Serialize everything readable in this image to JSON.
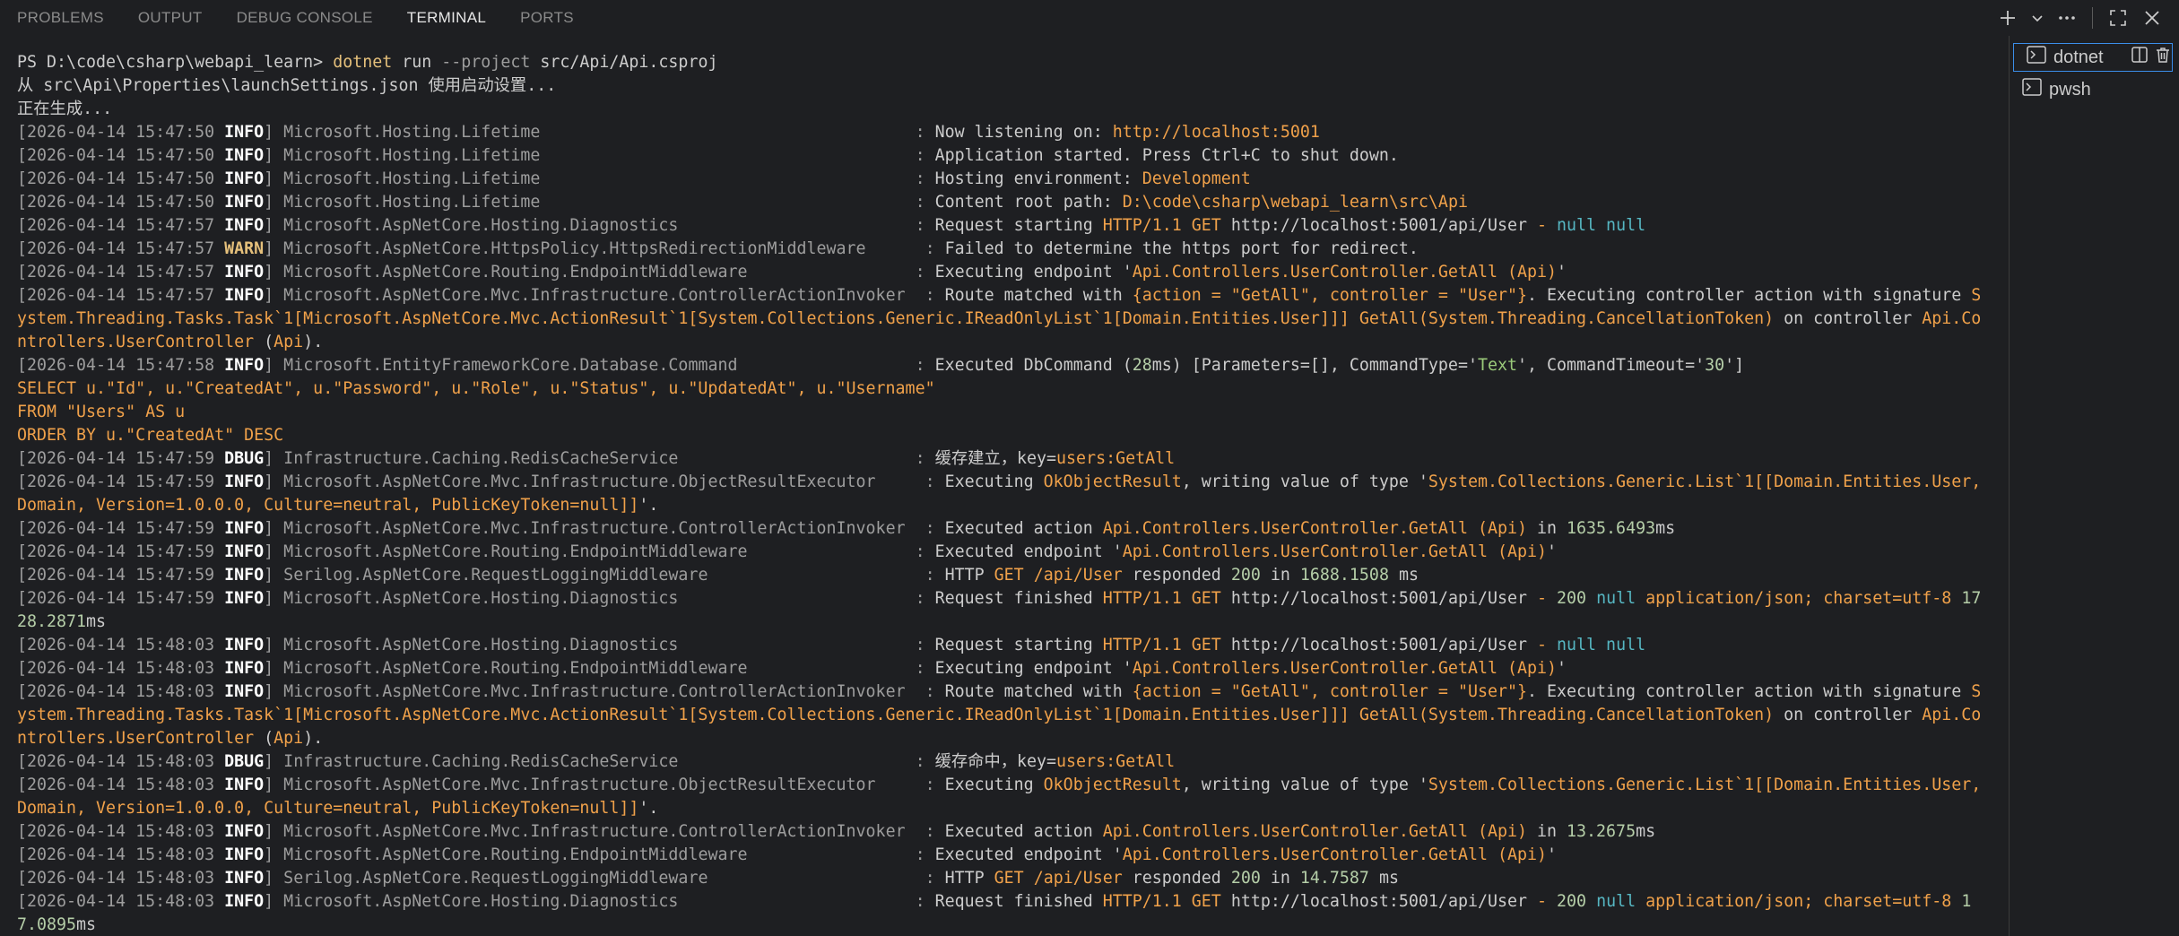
{
  "tabs": [
    {
      "label": "PROBLEMS"
    },
    {
      "label": "OUTPUT"
    },
    {
      "label": "DEBUG CONSOLE"
    },
    {
      "label": "TERMINAL"
    },
    {
      "label": "PORTS"
    }
  ],
  "active_tab": 3,
  "terminals": [
    {
      "label": "dotnet"
    },
    {
      "label": "pwsh"
    }
  ],
  "colors": {
    "background": "#1e1f22",
    "accent": "#3b8eea",
    "info": "#ffffff",
    "warn": "#e5c07b",
    "string": "#f0a14a",
    "keyword_null": "#56b6c2",
    "value_green": "#9ac97a"
  },
  "lines": [
    [
      {
        "t": "PS D:\\code\\csharp\\webapi_learn> ",
        "c": "default"
      },
      {
        "t": "dotnet",
        "c": "cmd"
      },
      {
        "t": " run ",
        "c": "default"
      },
      {
        "t": "--project",
        "c": "flag"
      },
      {
        "t": " src/Api/Api.csproj",
        "c": "default"
      }
    ],
    [
      {
        "t": "从 src\\Api\\Properties\\launchSettings.json 使用启动设置...",
        "c": "default"
      }
    ],
    [
      {
        "t": "正在生成...",
        "c": "default"
      }
    ],
    [
      {
        "t": "[2026-04-14 15:47:50 ",
        "c": "dim"
      },
      {
        "t": "INFO",
        "c": "white"
      },
      {
        "t": "] Microsoft.Hosting.Lifetime                                      : ",
        "c": "dim"
      },
      {
        "t": "Now listening on: ",
        "c": "default"
      },
      {
        "t": "http://localhost:5001",
        "c": "orange"
      }
    ],
    [
      {
        "t": "[2026-04-14 15:47:50 ",
        "c": "dim"
      },
      {
        "t": "INFO",
        "c": "white"
      },
      {
        "t": "] Microsoft.Hosting.Lifetime                                      : ",
        "c": "dim"
      },
      {
        "t": "Application started. Press Ctrl+C to shut down.",
        "c": "default"
      }
    ],
    [
      {
        "t": "[2026-04-14 15:47:50 ",
        "c": "dim"
      },
      {
        "t": "INFO",
        "c": "white"
      },
      {
        "t": "] Microsoft.Hosting.Lifetime                                      : ",
        "c": "dim"
      },
      {
        "t": "Hosting environment: ",
        "c": "default"
      },
      {
        "t": "Development",
        "c": "orange"
      }
    ],
    [
      {
        "t": "[2026-04-14 15:47:50 ",
        "c": "dim"
      },
      {
        "t": "INFO",
        "c": "white"
      },
      {
        "t": "] Microsoft.Hosting.Lifetime                                      : ",
        "c": "dim"
      },
      {
        "t": "Content root path: ",
        "c": "default"
      },
      {
        "t": "D:\\code\\csharp\\webapi_learn\\src\\Api",
        "c": "orange"
      }
    ],
    [
      {
        "t": "[2026-04-14 15:47:57 ",
        "c": "dim"
      },
      {
        "t": "INFO",
        "c": "white"
      },
      {
        "t": "] Microsoft.AspNetCore.Hosting.Diagnostics                        : ",
        "c": "dim"
      },
      {
        "t": "Request starting ",
        "c": "default"
      },
      {
        "t": "HTTP/1.1 GET ",
        "c": "orange"
      },
      {
        "t": "http://localhost:5001/api/User",
        "c": "default"
      },
      {
        "t": " - ",
        "c": "orange"
      },
      {
        "t": "null null",
        "c": "cyan"
      }
    ],
    [
      {
        "t": "[2026-04-14 15:47:57 ",
        "c": "dim"
      },
      {
        "t": "WARN",
        "c": "warn"
      },
      {
        "t": "] Microsoft.AspNetCore.HttpsPolicy.HttpsRedirectionMiddleware      : ",
        "c": "dim"
      },
      {
        "t": "Failed to determine the https port for redirect.",
        "c": "default"
      }
    ],
    [
      {
        "t": "[2026-04-14 15:47:57 ",
        "c": "dim"
      },
      {
        "t": "INFO",
        "c": "white"
      },
      {
        "t": "] Microsoft.AspNetCore.Routing.EndpointMiddleware                 : ",
        "c": "dim"
      },
      {
        "t": "Executing endpoint '",
        "c": "default"
      },
      {
        "t": "Api.Controllers.UserController.GetAll (Api)",
        "c": "orange"
      },
      {
        "t": "'",
        "c": "default"
      }
    ],
    [
      {
        "t": "[2026-04-14 15:47:57 ",
        "c": "dim"
      },
      {
        "t": "INFO",
        "c": "white"
      },
      {
        "t": "] Microsoft.AspNetCore.Mvc.Infrastructure.ControllerActionInvoker  : ",
        "c": "dim"
      },
      {
        "t": "Route matched with ",
        "c": "default"
      },
      {
        "t": "{action = \"GetAll\", controller = \"User\"}",
        "c": "orange"
      },
      {
        "t": ". Executing controller action with signature ",
        "c": "default"
      },
      {
        "t": "System.Threading.Tasks.Task`1[Microsoft.AspNetCore.Mvc.ActionResult`1[System.Collections.Generic.IReadOnlyList`1[Domain.Entities.User]]] GetAll(System.Threading.CancellationToken)",
        "c": "orange"
      },
      {
        "t": " on controller ",
        "c": "default"
      },
      {
        "t": "Api.Controllers.UserController",
        "c": "orange"
      },
      {
        "t": " (",
        "c": "default"
      },
      {
        "t": "Api",
        "c": "orange"
      },
      {
        "t": ").",
        "c": "default"
      }
    ],
    [
      {
        "t": "[2026-04-14 15:47:58 ",
        "c": "dim"
      },
      {
        "t": "INFO",
        "c": "white"
      },
      {
        "t": "] Microsoft.EntityFrameworkCore.Database.Command                  : ",
        "c": "dim"
      },
      {
        "t": "Executed DbCommand (",
        "c": "default"
      },
      {
        "t": "28",
        "c": "num"
      },
      {
        "t": "ms) [Parameters=[], CommandType='",
        "c": "default"
      },
      {
        "t": "Text",
        "c": "green"
      },
      {
        "t": "', CommandTimeout='",
        "c": "default"
      },
      {
        "t": "30",
        "c": "num"
      },
      {
        "t": "']",
        "c": "default"
      }
    ],
    [
      {
        "t": "SELECT u.\"Id\", u.\"CreatedAt\", u.\"Password\", u.\"Role\", u.\"Status\", u.\"UpdatedAt\", u.\"Username\"",
        "c": "orange"
      }
    ],
    [
      {
        "t": "FROM \"Users\" AS u",
        "c": "orange"
      }
    ],
    [
      {
        "t": "ORDER BY u.\"CreatedAt\" DESC",
        "c": "orange"
      }
    ],
    [
      {
        "t": "[2026-04-14 15:47:59 ",
        "c": "dim"
      },
      {
        "t": "DBUG",
        "c": "white"
      },
      {
        "t": "] Infrastructure.Caching.RedisCacheService                        : ",
        "c": "dim"
      },
      {
        "t": "缓存建立，key=",
        "c": "default"
      },
      {
        "t": "users:GetAll",
        "c": "orange"
      }
    ],
    [
      {
        "t": "[2026-04-14 15:47:59 ",
        "c": "dim"
      },
      {
        "t": "INFO",
        "c": "white"
      },
      {
        "t": "] Microsoft.AspNetCore.Mvc.Infrastructure.ObjectResultExecutor     : ",
        "c": "dim"
      },
      {
        "t": "Executing ",
        "c": "default"
      },
      {
        "t": "OkObjectResult",
        "c": "orange"
      },
      {
        "t": ", writing value of type '",
        "c": "default"
      },
      {
        "t": "System.Collections.Generic.List`1[[Domain.Entities.User, Domain, Version=1.0.0.0, Culture=neutral, PublicKeyToken=null]]",
        "c": "orange"
      },
      {
        "t": "'.",
        "c": "default"
      }
    ],
    [
      {
        "t": "[2026-04-14 15:47:59 ",
        "c": "dim"
      },
      {
        "t": "INFO",
        "c": "white"
      },
      {
        "t": "] Microsoft.AspNetCore.Mvc.Infrastructure.ControllerActionInvoker  : ",
        "c": "dim"
      },
      {
        "t": "Executed action ",
        "c": "default"
      },
      {
        "t": "Api.Controllers.UserController.GetAll (Api)",
        "c": "orange"
      },
      {
        "t": " in ",
        "c": "default"
      },
      {
        "t": "1635.6493",
        "c": "num"
      },
      {
        "t": "ms",
        "c": "default"
      }
    ],
    [
      {
        "t": "[2026-04-14 15:47:59 ",
        "c": "dim"
      },
      {
        "t": "INFO",
        "c": "white"
      },
      {
        "t": "] Microsoft.AspNetCore.Routing.EndpointMiddleware                 : ",
        "c": "dim"
      },
      {
        "t": "Executed endpoint '",
        "c": "default"
      },
      {
        "t": "Api.Controllers.UserController.GetAll (Api)",
        "c": "orange"
      },
      {
        "t": "'",
        "c": "default"
      }
    ],
    [
      {
        "t": "[2026-04-14 15:47:59 ",
        "c": "dim"
      },
      {
        "t": "INFO",
        "c": "white"
      },
      {
        "t": "] Serilog.AspNetCore.RequestLoggingMiddleware                      : ",
        "c": "dim"
      },
      {
        "t": "HTTP ",
        "c": "default"
      },
      {
        "t": "GET",
        "c": "orange"
      },
      {
        "t": " ",
        "c": "default"
      },
      {
        "t": "/api/User",
        "c": "orange"
      },
      {
        "t": " responded ",
        "c": "default"
      },
      {
        "t": "200",
        "c": "num"
      },
      {
        "t": " in ",
        "c": "default"
      },
      {
        "t": "1688.1508",
        "c": "num"
      },
      {
        "t": " ms",
        "c": "default"
      }
    ],
    [
      {
        "t": "[2026-04-14 15:47:59 ",
        "c": "dim"
      },
      {
        "t": "INFO",
        "c": "white"
      },
      {
        "t": "] Microsoft.AspNetCore.Hosting.Diagnostics                        : ",
        "c": "dim"
      },
      {
        "t": "Request finished ",
        "c": "default"
      },
      {
        "t": "HTTP/1.1 GET ",
        "c": "orange"
      },
      {
        "t": "http://localhost:5001/api/User",
        "c": "default"
      },
      {
        "t": " - ",
        "c": "orange"
      },
      {
        "t": "200",
        "c": "num"
      },
      {
        "t": " ",
        "c": "default"
      },
      {
        "t": "null",
        "c": "cyan"
      },
      {
        "t": " application/json; charset=utf-8 ",
        "c": "orange"
      },
      {
        "t": "1728.2871",
        "c": "num"
      },
      {
        "t": "ms",
        "c": "default"
      }
    ],
    [
      {
        "t": "[2026-04-14 15:48:03 ",
        "c": "dim"
      },
      {
        "t": "INFO",
        "c": "white"
      },
      {
        "t": "] Microsoft.AspNetCore.Hosting.Diagnostics                        : ",
        "c": "dim"
      },
      {
        "t": "Request starting ",
        "c": "default"
      },
      {
        "t": "HTTP/1.1 GET ",
        "c": "orange"
      },
      {
        "t": "http://localhost:5001/api/User",
        "c": "default"
      },
      {
        "t": " - ",
        "c": "orange"
      },
      {
        "t": "null null",
        "c": "cyan"
      }
    ],
    [
      {
        "t": "[2026-04-14 15:48:03 ",
        "c": "dim"
      },
      {
        "t": "INFO",
        "c": "white"
      },
      {
        "t": "] Microsoft.AspNetCore.Routing.EndpointMiddleware                 : ",
        "c": "dim"
      },
      {
        "t": "Executing endpoint '",
        "c": "default"
      },
      {
        "t": "Api.Controllers.UserController.GetAll (Api)",
        "c": "orange"
      },
      {
        "t": "'",
        "c": "default"
      }
    ],
    [
      {
        "t": "[2026-04-14 15:48:03 ",
        "c": "dim"
      },
      {
        "t": "INFO",
        "c": "white"
      },
      {
        "t": "] Microsoft.AspNetCore.Mvc.Infrastructure.ControllerActionInvoker  : ",
        "c": "dim"
      },
      {
        "t": "Route matched with ",
        "c": "default"
      },
      {
        "t": "{action = \"GetAll\", controller = \"User\"}",
        "c": "orange"
      },
      {
        "t": ". Executing controller action with signature ",
        "c": "default"
      },
      {
        "t": "System.Threading.Tasks.Task`1[Microsoft.AspNetCore.Mvc.ActionResult`1[System.Collections.Generic.IReadOnlyList`1[Domain.Entities.User]]] GetAll(System.Threading.CancellationToken)",
        "c": "orange"
      },
      {
        "t": " on controller ",
        "c": "default"
      },
      {
        "t": "Api.Controllers.UserController",
        "c": "orange"
      },
      {
        "t": " (",
        "c": "default"
      },
      {
        "t": "Api",
        "c": "orange"
      },
      {
        "t": ").",
        "c": "default"
      }
    ],
    [
      {
        "t": "[2026-04-14 15:48:03 ",
        "c": "dim"
      },
      {
        "t": "DBUG",
        "c": "white"
      },
      {
        "t": "] Infrastructure.Caching.RedisCacheService                        : ",
        "c": "dim"
      },
      {
        "t": "缓存命中，key=",
        "c": "default"
      },
      {
        "t": "users:GetAll",
        "c": "orange"
      }
    ],
    [
      {
        "t": "[2026-04-14 15:48:03 ",
        "c": "dim"
      },
      {
        "t": "INFO",
        "c": "white"
      },
      {
        "t": "] Microsoft.AspNetCore.Mvc.Infrastructure.ObjectResultExecutor     : ",
        "c": "dim"
      },
      {
        "t": "Executing ",
        "c": "default"
      },
      {
        "t": "OkObjectResult",
        "c": "orange"
      },
      {
        "t": ", writing value of type '",
        "c": "default"
      },
      {
        "t": "System.Collections.Generic.List`1[[Domain.Entities.User, Domain, Version=1.0.0.0, Culture=neutral, PublicKeyToken=null]]",
        "c": "orange"
      },
      {
        "t": "'.",
        "c": "default"
      }
    ],
    [
      {
        "t": "[2026-04-14 15:48:03 ",
        "c": "dim"
      },
      {
        "t": "INFO",
        "c": "white"
      },
      {
        "t": "] Microsoft.AspNetCore.Mvc.Infrastructure.ControllerActionInvoker  : ",
        "c": "dim"
      },
      {
        "t": "Executed action ",
        "c": "default"
      },
      {
        "t": "Api.Controllers.UserController.GetAll (Api)",
        "c": "orange"
      },
      {
        "t": " in ",
        "c": "default"
      },
      {
        "t": "13.2675",
        "c": "num"
      },
      {
        "t": "ms",
        "c": "default"
      }
    ],
    [
      {
        "t": "[2026-04-14 15:48:03 ",
        "c": "dim"
      },
      {
        "t": "INFO",
        "c": "white"
      },
      {
        "t": "] Microsoft.AspNetCore.Routing.EndpointMiddleware                 : ",
        "c": "dim"
      },
      {
        "t": "Executed endpoint '",
        "c": "default"
      },
      {
        "t": "Api.Controllers.UserController.GetAll (Api)",
        "c": "orange"
      },
      {
        "t": "'",
        "c": "default"
      }
    ],
    [
      {
        "t": "[2026-04-14 15:48:03 ",
        "c": "dim"
      },
      {
        "t": "INFO",
        "c": "white"
      },
      {
        "t": "] Serilog.AspNetCore.RequestLoggingMiddleware                      : ",
        "c": "dim"
      },
      {
        "t": "HTTP ",
        "c": "default"
      },
      {
        "t": "GET",
        "c": "orange"
      },
      {
        "t": " ",
        "c": "default"
      },
      {
        "t": "/api/User",
        "c": "orange"
      },
      {
        "t": " responded ",
        "c": "default"
      },
      {
        "t": "200",
        "c": "num"
      },
      {
        "t": " in ",
        "c": "default"
      },
      {
        "t": "14.7587",
        "c": "num"
      },
      {
        "t": " ms",
        "c": "default"
      }
    ],
    [
      {
        "t": "[2026-04-14 15:48:03 ",
        "c": "dim"
      },
      {
        "t": "INFO",
        "c": "white"
      },
      {
        "t": "] Microsoft.AspNetCore.Hosting.Diagnostics                        : ",
        "c": "dim"
      },
      {
        "t": "Request finished ",
        "c": "default"
      },
      {
        "t": "HTTP/1.1 GET ",
        "c": "orange"
      },
      {
        "t": "http://localhost:5001/api/User",
        "c": "default"
      },
      {
        "t": " - ",
        "c": "orange"
      },
      {
        "t": "200",
        "c": "num"
      },
      {
        "t": " ",
        "c": "default"
      },
      {
        "t": "null",
        "c": "cyan"
      },
      {
        "t": " application/json; charset=utf-8 ",
        "c": "orange"
      },
      {
        "t": "17.0895",
        "c": "num"
      },
      {
        "t": "ms",
        "c": "default"
      }
    ]
  ]
}
